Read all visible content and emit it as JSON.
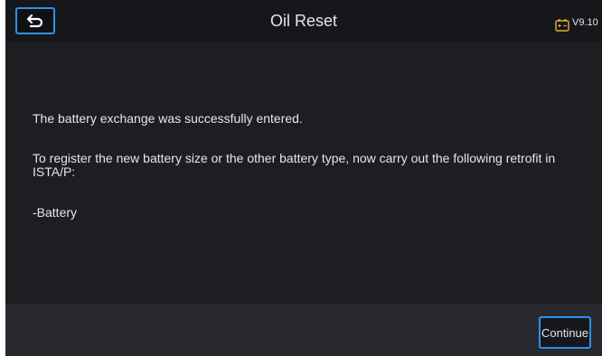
{
  "header": {
    "title": "Oil Reset",
    "version": "V9.10",
    "back_icon": "back-arrow-icon",
    "status_icon": "battery-icon"
  },
  "main": {
    "messages": [
      "The battery exchange was successfully entered.",
      "To register the new battery size or the other battery type, now carry out the following retrofit in ISTA/P:",
      "-Battery"
    ]
  },
  "footer": {
    "continue_label": "Continue"
  },
  "colors": {
    "accent": "#2e8ff0",
    "background": "#1d1e22",
    "footer": "#27292e",
    "text": "#e4e6ea"
  }
}
